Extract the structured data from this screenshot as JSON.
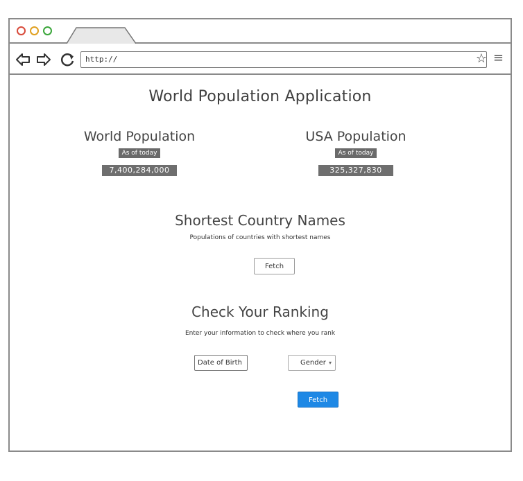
{
  "browser": {
    "url": "http://",
    "star_icon": "☆",
    "menu_icon": "≡"
  },
  "app": {
    "title": "World Population Application"
  },
  "world": {
    "heading": "World Population",
    "badge": "As of today",
    "count": "7,400,284,000"
  },
  "usa": {
    "heading": "USA Population",
    "badge": "As of today",
    "count": "325,327,830"
  },
  "shortest": {
    "title": "Shortest Country Names",
    "subtitle": "Populations of countries with shortest names",
    "button": "Fetch"
  },
  "ranking": {
    "title": "Check Your Ranking",
    "subtitle": "Enter your information to check where you rank",
    "dob_placeholder": "Date of Birth",
    "gender_label": "Gender",
    "caret": "▾",
    "button": "Fetch"
  },
  "colors": {
    "primary_button": "#1e88e5",
    "badge_bg": "#6a6a6a",
    "close_dot": "#d84a3a",
    "minimize_dot": "#e0a020",
    "maximize_dot": "#3aa63a"
  }
}
